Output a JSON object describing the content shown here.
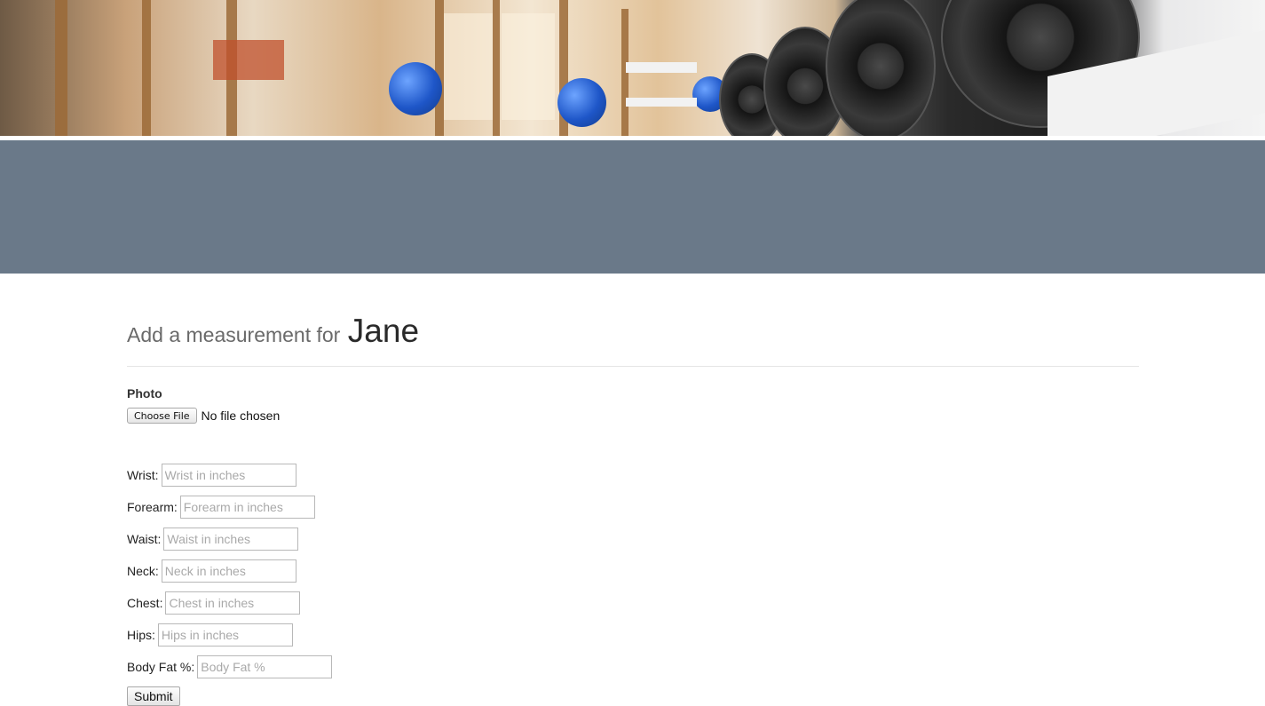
{
  "hero": {
    "description_icon": "gym-dumbbells-photo"
  },
  "heading": {
    "lead": "Add a measurement for",
    "name": "Jane"
  },
  "photo": {
    "label": "Photo",
    "button_label": "Choose File",
    "status": "No file chosen"
  },
  "fields": [
    {
      "label": "Wrist:",
      "placeholder": "Wrist in inches"
    },
    {
      "label": "Forearm:",
      "placeholder": "Forearm in inches"
    },
    {
      "label": "Waist:",
      "placeholder": "Waist in inches"
    },
    {
      "label": "Neck:",
      "placeholder": "Neck in inches"
    },
    {
      "label": "Chest:",
      "placeholder": "Chest in inches"
    },
    {
      "label": "Hips:",
      "placeholder": "Hips in inches"
    },
    {
      "label": "Body Fat %:",
      "placeholder": "Body Fat %"
    }
  ],
  "submit_label": "Submit",
  "colors": {
    "band": "#6a7989",
    "divider": "#e5e5e5"
  }
}
